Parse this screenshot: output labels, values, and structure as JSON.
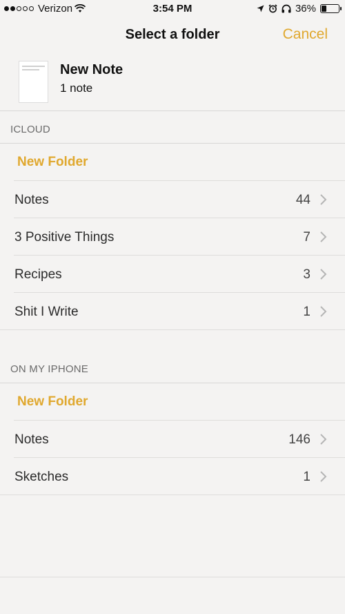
{
  "status": {
    "carrier": "Verizon",
    "time": "3:54 PM",
    "battery": "36%",
    "battery_level": 0.36
  },
  "nav": {
    "title": "Select a folder",
    "cancel": "Cancel"
  },
  "note": {
    "title": "New Note",
    "count": "1 note"
  },
  "icloud": {
    "header": "ICLOUD",
    "new_folder": "New Folder",
    "folders": [
      {
        "name": "Notes",
        "count": "44"
      },
      {
        "name": "3 Positive Things",
        "count": "7"
      },
      {
        "name": "Recipes",
        "count": "3"
      },
      {
        "name": "Shit I Write",
        "count": "1"
      }
    ]
  },
  "iphone": {
    "header": "ON MY IPHONE",
    "new_folder": "New Folder",
    "folders": [
      {
        "name": "Notes",
        "count": "146"
      },
      {
        "name": "Sketches",
        "count": "1"
      }
    ]
  },
  "colors": {
    "accent": "#e0a82e",
    "background": "#f4f3f2"
  },
  "icons": [
    "signal-dots-icon",
    "wifi-icon",
    "location-icon",
    "alarm-icon",
    "headphones-icon",
    "battery-icon",
    "chevron-right-icon"
  ]
}
